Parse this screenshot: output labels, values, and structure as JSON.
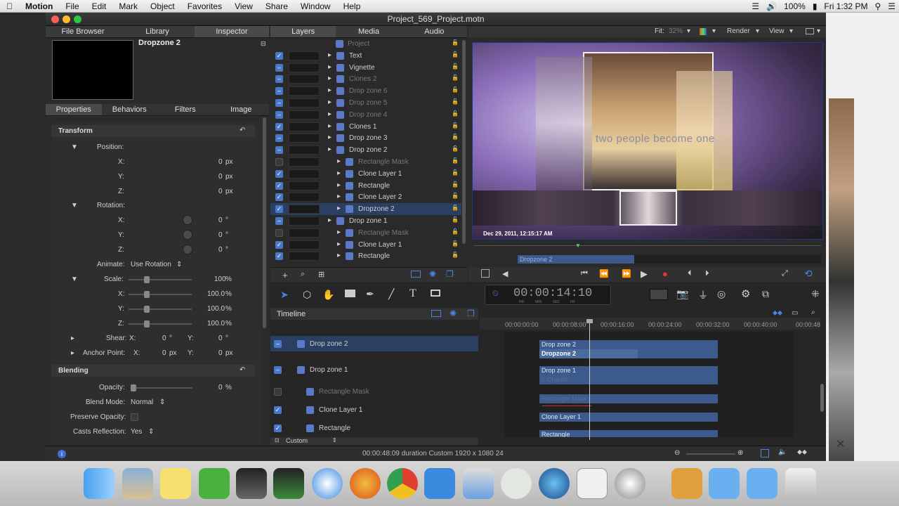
{
  "menubar": {
    "apple": "",
    "app_name": "Motion",
    "items": [
      "File",
      "Edit",
      "Mark",
      "Object",
      "Favorites",
      "View",
      "Share",
      "Window",
      "Help"
    ],
    "battery": "100%",
    "clock": "Fri 1:32 PM"
  },
  "window": {
    "title": "Project_569_Project.motn"
  },
  "left": {
    "tabs": [
      "File Browser",
      "Library",
      "Inspector"
    ],
    "preview_title": "Dropzone 2",
    "sub_tabs": [
      "Properties",
      "Behaviors",
      "Filters",
      "Image"
    ],
    "transform": {
      "header": "Transform",
      "position": "Position:",
      "pos_x": "0",
      "pos_y": "0",
      "pos_z": "0",
      "unit_px": "px",
      "rotation": "Rotation:",
      "rot_x": "0",
      "rot_y": "0",
      "rot_z": "0",
      "unit_deg": "°",
      "animate_label": "Animate:",
      "animate_value": "Use Rotation",
      "scale": "Scale:",
      "scale_val": "100",
      "scale_x": "100.0",
      "scale_y": "100.0",
      "scale_z": "100.0",
      "unit_pct": "%",
      "shear": "Shear:",
      "shear_x": "0",
      "shear_y": "0",
      "anchor": "Anchor Point:",
      "anchor_x": "0",
      "anchor_y": "0",
      "x": "X:",
      "y": "Y:",
      "z": "Z:"
    },
    "blending": {
      "header": "Blending",
      "opacity_label": "Opacity:",
      "opacity_val": "0",
      "blend_label": "Blend Mode:",
      "blend_val": "Normal",
      "preserve_label": "Preserve Opacity:",
      "casts_label": "Casts Reflection:",
      "casts_val": "Yes"
    }
  },
  "layers": {
    "tabs": [
      "Layers",
      "Media",
      "Audio"
    ],
    "rows": [
      {
        "name": "Project",
        "checked": "none",
        "dim": true
      },
      {
        "name": "Text",
        "checked": "on",
        "dim": false
      },
      {
        "name": "Vignette",
        "checked": "minus",
        "dim": false
      },
      {
        "name": "Clones 2",
        "checked": "minus",
        "dim": true
      },
      {
        "name": "Drop zone 6",
        "checked": "minus",
        "dim": true
      },
      {
        "name": "Drop zone 5",
        "checked": "minus",
        "dim": true
      },
      {
        "name": "Drop zone 4",
        "checked": "minus",
        "dim": true
      },
      {
        "name": "Clones 1",
        "checked": "on",
        "dim": false
      },
      {
        "name": "Drop zone 3",
        "checked": "minus",
        "dim": false
      },
      {
        "name": "Drop zone 2",
        "checked": "minus",
        "dim": false
      },
      {
        "name": "Rectangle Mask",
        "checked": "off",
        "dim": true
      },
      {
        "name": "Clone Layer 1",
        "checked": "on",
        "dim": false
      },
      {
        "name": "Rectangle",
        "checked": "on",
        "dim": false
      },
      {
        "name": "Clone Layer 2",
        "checked": "on",
        "dim": false
      },
      {
        "name": "Dropzone 2",
        "checked": "on",
        "dim": false
      },
      {
        "name": "Drop zone 1",
        "checked": "minus",
        "dim": false
      },
      {
        "name": "Rectangle Mask",
        "checked": "off",
        "dim": true
      },
      {
        "name": "Clone Layer 1",
        "checked": "on",
        "dim": false
      },
      {
        "name": "Rectangle",
        "checked": "on",
        "dim": false
      }
    ]
  },
  "canvas": {
    "fit_label": "Fit:",
    "fit_value": "32%",
    "render": "Render",
    "view": "View",
    "overlay_text": "two people become one",
    "timestamp": "Dec 29, 2011, 12:15:17 AM",
    "mini_clip": "Dropzone 2",
    "timecode": "00:00:14:10",
    "tc_units": [
      "HR",
      "MIN",
      "SEC",
      "FR"
    ]
  },
  "timeline": {
    "title": "Timeline",
    "ruler": [
      "00:00:00:00",
      "00:00:08:00",
      "00:00:16:00",
      "00:00:24:00",
      "00:00:32:00",
      "00:00:40:00",
      "00:00:48"
    ],
    "tracks": [
      {
        "name": "Drop zone 2"
      },
      {
        "name": "Drop zone 1"
      },
      {
        "name": "Rectangle Mask"
      },
      {
        "name": "Clone Layer 1"
      },
      {
        "name": "Rectangle"
      }
    ],
    "clips": {
      "dz2a": "Drop zone 2",
      "dz2b": "Dropzone 2",
      "dz1": "Drop zone 1",
      "objects": "5 Objects",
      "rmask": "Rectangle Mask",
      "cl1": "Clone Layer 1",
      "rect": "Rectangle"
    },
    "custom": "Custom"
  },
  "status": {
    "text": "00:00:48:09 duration Custom 1920 x 1080 24"
  },
  "colors": {
    "accent": "#3f6fd1",
    "selection": "#2b3f63"
  }
}
